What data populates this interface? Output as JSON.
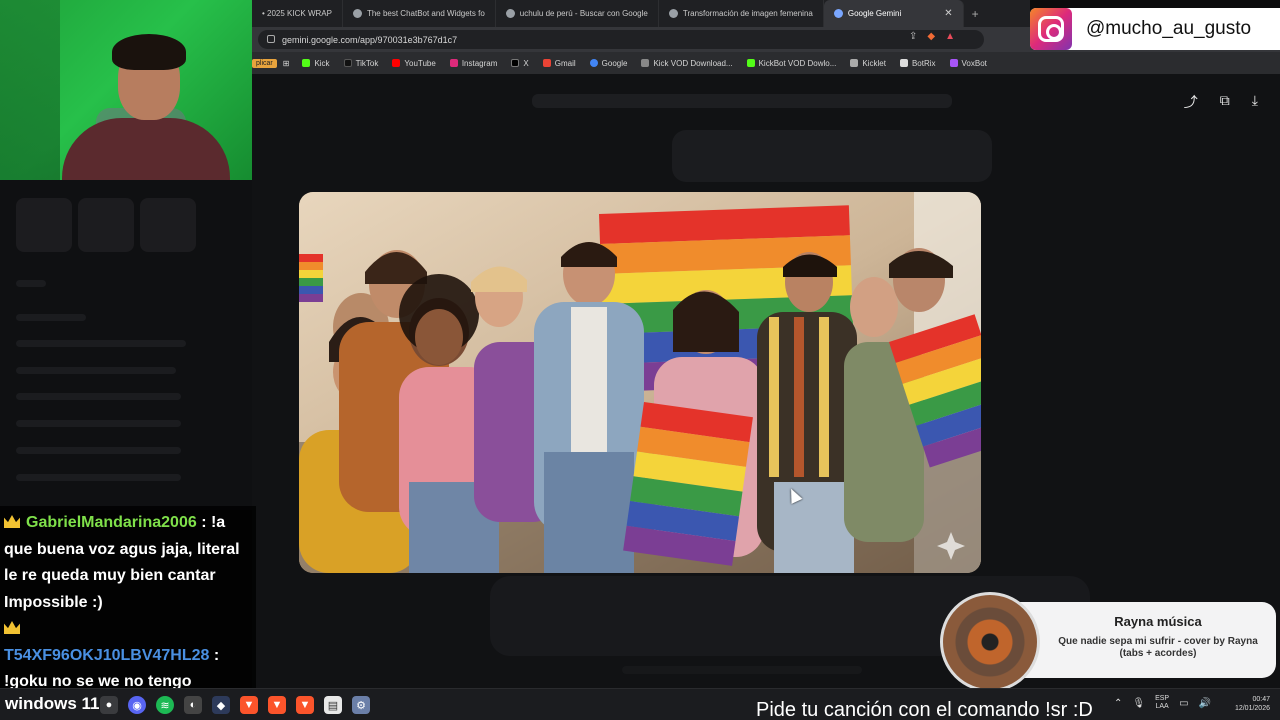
{
  "browser": {
    "tabs": [
      {
        "label": "• 2025 KICK WRAP",
        "active": false
      },
      {
        "label": "The best ChatBot and Widgets fo",
        "active": false
      },
      {
        "label": "uchulu de perú - Buscar con Google",
        "active": false
      },
      {
        "label": "Transformación de imagen femenina",
        "active": false
      },
      {
        "label": "Google Gemini",
        "active": true
      }
    ],
    "new_tab": "+",
    "url": "gemini.google.com/app/970031e3b767d1c7",
    "bookmarks_cut": "plicar",
    "bookmarks": [
      "Kick",
      "TikTok",
      "YouTube",
      "Instagram",
      "X",
      "Gmail",
      "Google",
      "Kick VOD Download...",
      "KickBot VOD Dowlo...",
      "Kicklet",
      "BotRix",
      "VoxBot"
    ]
  },
  "instagram": {
    "handle": "@mucho_au_gusto"
  },
  "chat": {
    "messages": [
      {
        "user": "GabrielMandarina2006",
        "separator": " : ",
        "text": "!a que buena voz agus jaja, literal le re queda muy bien cantar Impossible :)"
      },
      {
        "user": "T54XF96OKJ10LBV47HL28",
        "separator": " : ",
        "text": "!goku no se we no tengo"
      }
    ]
  },
  "music": {
    "title": "Rayna música",
    "subtitle": "Que nadie sepa mi sufrir - cover by Rayna (tabs + acordes)"
  },
  "taskbar": {
    "start_label": "windows 11",
    "song_command": "Pide tu canción con el comando !sr :D",
    "lang_top": "ESP",
    "lang_bottom": "LAA",
    "time": "00:47",
    "date": "12/01/2026"
  },
  "colors": {
    "accent_green": "#7fe04a",
    "accent_blue": "#4a90e2",
    "crown": "#f2c232"
  }
}
